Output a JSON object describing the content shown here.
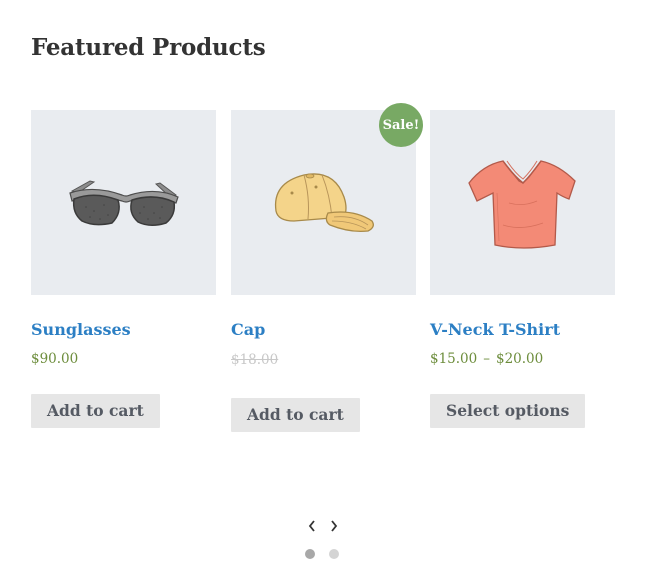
{
  "section": {
    "title": "Featured Products"
  },
  "products": [
    {
      "name": "Sunglasses",
      "price": "$90.00",
      "button": "Add to cart",
      "icon": "sunglasses"
    },
    {
      "name": "Cap",
      "sale_badge": "Sale!",
      "price_old": "$18.00",
      "button": "Add to cart",
      "icon": "cap"
    },
    {
      "name": "V-Neck T-Shirt",
      "price_min": "$15.00",
      "price_sep": "–",
      "price_max": "$20.00",
      "button": "Select options",
      "icon": "t-shirt"
    }
  ],
  "carousel": {
    "prev_icon": "chevron-left",
    "next_icon": "chevron-right",
    "pages": 2,
    "active_page": 1
  },
  "colors": {
    "link": "#2c7fc4",
    "price": "#6d8d3c",
    "sale_badge": "#78a964",
    "button_bg": "#e6e6e6",
    "thumb_bg": "#e9ecf0"
  }
}
